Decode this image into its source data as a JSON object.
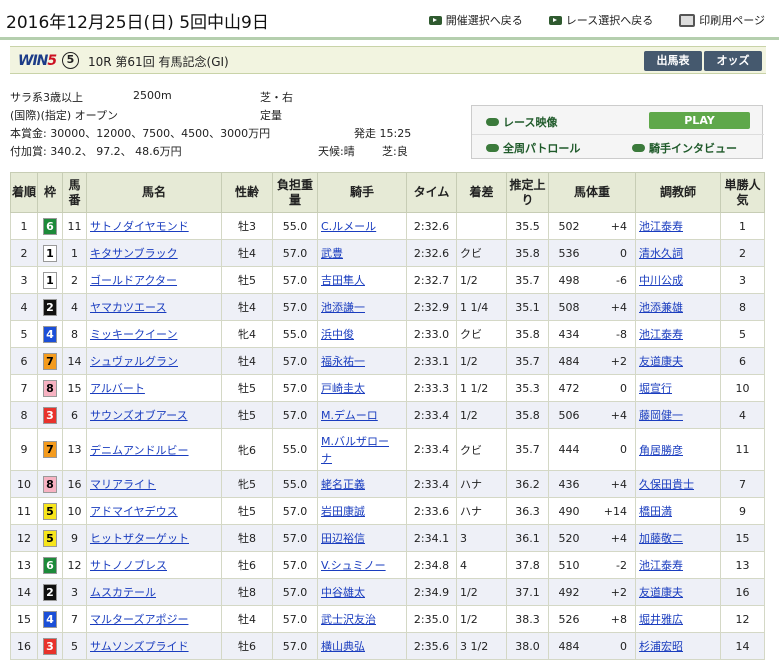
{
  "page": {
    "date": "2016年12月25日(日) 5回中山9日",
    "links": [
      {
        "label": "開催選択へ戻る"
      },
      {
        "label": "レース選択へ戻る"
      },
      {
        "label": "印刷用ページ"
      }
    ]
  },
  "race": {
    "brand": "WIN5",
    "win5_number": "⑤",
    "title": "10R 第61回 有馬記念(GI)",
    "buttons": [
      "出馬表",
      "オッズ"
    ],
    "conditions": "サラ系3歳以上",
    "distance": "2500m",
    "course": "芝・右",
    "class": "(国際)(指定) オープン",
    "weight_rule": "定量",
    "prize": "本賞金: 30000、12000、7500、4500、3000万円",
    "start": "発走 15:25",
    "added_prize": "付加賞:  340.2、  97.2、 48.6万円",
    "weather": "天候:晴",
    "going": "芝:良"
  },
  "media": {
    "race_video": "レース映像",
    "play": "PLAY",
    "patrol": "全周パトロール",
    "interview": "騎手インタビュー"
  },
  "table": {
    "headers": [
      "着順",
      "枠",
      "馬番",
      "馬名",
      "性齢",
      "負担重量",
      "騎手",
      "タイム",
      "着差",
      "推定上り",
      "馬体重",
      "調教師",
      "単勝人気"
    ],
    "rows": [
      {
        "pos": "1",
        "waku": "6",
        "num": "11",
        "horse": "サトノダイヤモンド",
        "sexage": "牡3",
        "weight": "55.0",
        "jockey": "C.ルメール",
        "time": "2:32.6",
        "margin": "",
        "last3f": "35.5",
        "bw": "502",
        "diff": "+4",
        "trainer": "池江泰寿",
        "pop": "1"
      },
      {
        "pos": "2",
        "waku": "1",
        "num": "1",
        "horse": "キタサンブラック",
        "sexage": "牡4",
        "weight": "57.0",
        "jockey": "武豊",
        "time": "2:32.6",
        "margin": "クビ",
        "last3f": "35.8",
        "bw": "536",
        "diff": "0",
        "trainer": "清水久詞",
        "pop": "2"
      },
      {
        "pos": "3",
        "waku": "1",
        "num": "2",
        "horse": "ゴールドアクター",
        "sexage": "牡5",
        "weight": "57.0",
        "jockey": "吉田隼人",
        "time": "2:32.7",
        "margin": "1/2",
        "last3f": "35.7",
        "bw": "498",
        "diff": "-6",
        "trainer": "中川公成",
        "pop": "3"
      },
      {
        "pos": "4",
        "waku": "2",
        "num": "4",
        "horse": "ヤマカツエース",
        "sexage": "牡4",
        "weight": "57.0",
        "jockey": "池添謙一",
        "time": "2:32.9",
        "margin": "1 1/4",
        "last3f": "35.1",
        "bw": "508",
        "diff": "+4",
        "trainer": "池添兼雄",
        "pop": "8"
      },
      {
        "pos": "5",
        "waku": "4",
        "num": "8",
        "horse": "ミッキークイーン",
        "sexage": "牝4",
        "weight": "55.0",
        "jockey": "浜中俊",
        "time": "2:33.0",
        "margin": "クビ",
        "last3f": "35.8",
        "bw": "434",
        "diff": "-8",
        "trainer": "池江泰寿",
        "pop": "5"
      },
      {
        "pos": "6",
        "waku": "7",
        "num": "14",
        "horse": "シュヴァルグラン",
        "sexage": "牡4",
        "weight": "57.0",
        "jockey": "福永祐一",
        "time": "2:33.1",
        "margin": "1/2",
        "last3f": "35.7",
        "bw": "484",
        "diff": "+2",
        "trainer": "友道康夫",
        "pop": "6"
      },
      {
        "pos": "7",
        "waku": "8",
        "num": "15",
        "horse": "アルバート",
        "sexage": "牡5",
        "weight": "57.0",
        "jockey": "戸崎圭太",
        "time": "2:33.3",
        "margin": "1 1/2",
        "last3f": "35.3",
        "bw": "472",
        "diff": "0",
        "trainer": "堀宣行",
        "pop": "10"
      },
      {
        "pos": "8",
        "waku": "3",
        "num": "6",
        "horse": "サウンズオブアース",
        "sexage": "牡5",
        "weight": "57.0",
        "jockey": "M.デムーロ",
        "time": "2:33.4",
        "margin": "1/2",
        "last3f": "35.8",
        "bw": "506",
        "diff": "+4",
        "trainer": "藤岡健一",
        "pop": "4"
      },
      {
        "pos": "9",
        "waku": "7",
        "num": "13",
        "horse": "デニムアンドルビー",
        "sexage": "牝6",
        "weight": "55.0",
        "jockey": "M.バルザローナ",
        "time": "2:33.4",
        "margin": "クビ",
        "last3f": "35.7",
        "bw": "444",
        "diff": "0",
        "trainer": "角居勝彦",
        "pop": "11",
        "tall": true
      },
      {
        "pos": "10",
        "waku": "8",
        "num": "16",
        "horse": "マリアライト",
        "sexage": "牝5",
        "weight": "55.0",
        "jockey": "蛯名正義",
        "time": "2:33.4",
        "margin": "ハナ",
        "last3f": "36.2",
        "bw": "436",
        "diff": "+4",
        "trainer": "久保田貴士",
        "pop": "7"
      },
      {
        "pos": "11",
        "waku": "5",
        "num": "10",
        "horse": "アドマイヤデウス",
        "sexage": "牡5",
        "weight": "57.0",
        "jockey": "岩田康誠",
        "time": "2:33.6",
        "margin": "ハナ",
        "last3f": "36.3",
        "bw": "490",
        "diff": "+14",
        "trainer": "橋田満",
        "pop": "9"
      },
      {
        "pos": "12",
        "waku": "5",
        "num": "9",
        "horse": "ヒットザターゲット",
        "sexage": "牡8",
        "weight": "57.0",
        "jockey": "田辺裕信",
        "time": "2:34.1",
        "margin": "3",
        "last3f": "36.1",
        "bw": "520",
        "diff": "+4",
        "trainer": "加藤敬二",
        "pop": "15"
      },
      {
        "pos": "13",
        "waku": "6",
        "num": "12",
        "horse": "サトノノブレス",
        "sexage": "牡6",
        "weight": "57.0",
        "jockey": "V.シュミノー",
        "time": "2:34.8",
        "margin": "4",
        "last3f": "37.8",
        "bw": "510",
        "diff": "-2",
        "trainer": "池江泰寿",
        "pop": "13"
      },
      {
        "pos": "14",
        "waku": "2",
        "num": "3",
        "horse": "ムスカテール",
        "sexage": "牡8",
        "weight": "57.0",
        "jockey": "中谷雄太",
        "time": "2:34.9",
        "margin": "1/2",
        "last3f": "37.1",
        "bw": "492",
        "diff": "+2",
        "trainer": "友道康夫",
        "pop": "16"
      },
      {
        "pos": "15",
        "waku": "4",
        "num": "7",
        "horse": "マルターズアポジー",
        "sexage": "牡4",
        "weight": "57.0",
        "jockey": "武士沢友治",
        "time": "2:35.0",
        "margin": "1/2",
        "last3f": "38.3",
        "bw": "526",
        "diff": "+8",
        "trainer": "堀井雅広",
        "pop": "12"
      },
      {
        "pos": "16",
        "waku": "3",
        "num": "5",
        "horse": "サムソンズプライド",
        "sexage": "牡6",
        "weight": "57.0",
        "jockey": "横山典弘",
        "time": "2:35.6",
        "margin": "3 1/2",
        "last3f": "38.0",
        "bw": "484",
        "diff": "0",
        "trainer": "杉浦宏昭",
        "pop": "14"
      }
    ]
  },
  "waku_colors": {
    "1": {
      "bg": "#ffffff",
      "fg": "#000000"
    },
    "2": {
      "bg": "#111111",
      "fg": "#ffffff"
    },
    "3": {
      "bg": "#e8322c",
      "fg": "#ffffff"
    },
    "4": {
      "bg": "#1b4fd8",
      "fg": "#ffffff"
    },
    "5": {
      "bg": "#f7e51c",
      "fg": "#000000"
    },
    "6": {
      "bg": "#1d8a3a",
      "fg": "#ffffff"
    },
    "7": {
      "bg": "#f49b1e",
      "fg": "#000000"
    },
    "8": {
      "bg": "#f7b2c2",
      "fg": "#000000"
    }
  }
}
